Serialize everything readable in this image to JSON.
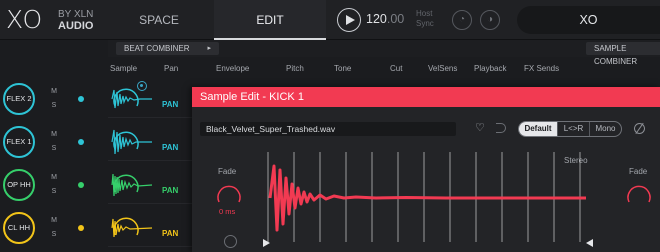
{
  "logo": {
    "mark": "XO",
    "by": "BY XLN",
    "audio": "AUDIO"
  },
  "tabs": {
    "space": "SPACE",
    "edit": "EDIT"
  },
  "transport": {
    "bpm_int": "120",
    "bpm_dec": ".00",
    "host_sync": "Host Sync"
  },
  "preset": {
    "name": "XO"
  },
  "combiner": {
    "left_label": "BEAT COMBINER",
    "left_arrow": "▸",
    "right_label": "SAMPLE COMBINER"
  },
  "columns": [
    "Sample",
    "Pan",
    "Envelope",
    "Pitch",
    "Tone",
    "Cut",
    "VelSens",
    "Playback",
    "FX Sends"
  ],
  "channels": [
    {
      "name": "FLEX 2",
      "m": "M",
      "s": "S",
      "color": "#2ec4d6"
    },
    {
      "name": "FLEX 1",
      "m": "M",
      "s": "S",
      "color": "#2ec4d6"
    },
    {
      "name": "OP HH",
      "m": "M",
      "s": "S",
      "color": "#36cf6b"
    },
    {
      "name": "CL HH",
      "m": "M",
      "s": "S",
      "color": "#f2c419"
    }
  ],
  "pan_label": "PAN",
  "sample_edit": {
    "title": "Sample Edit - KICK 1",
    "file": "Black_Velvet_Super_Trashed.wav",
    "modes": [
      "Default",
      "L<>R",
      "Mono"
    ],
    "fade_left_label": "Fade",
    "fade_left_value": "0 ms",
    "fade_right_label": "Fade",
    "stereo_label": "Stereo",
    "accent": "#f23a52"
  }
}
